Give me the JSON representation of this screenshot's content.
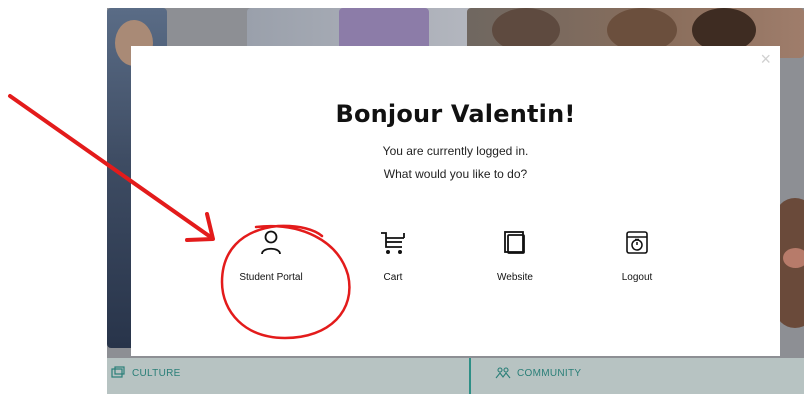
{
  "modal": {
    "title": "Bonjour Valentin!",
    "line1": "You are currently logged in.",
    "line2": "What would you like to do?",
    "close_icon": "×",
    "options": [
      {
        "label": "Student Portal",
        "icon": "user-icon"
      },
      {
        "label": "Cart",
        "icon": "cart-icon"
      },
      {
        "label": "Website",
        "icon": "window-stack-icon"
      },
      {
        "label": "Logout",
        "icon": "logout-timer-icon"
      }
    ]
  },
  "background": {
    "culture_label": "CULTURE",
    "community_label": "COMMUNITY"
  },
  "colors": {
    "annotation_red": "#e31b1b",
    "accent_teal": "#2a7f78"
  }
}
